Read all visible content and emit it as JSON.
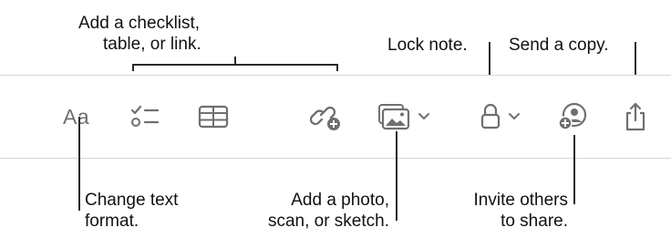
{
  "callouts": {
    "checklist_table_link": [
      "Add a checklist,",
      "table, or link."
    ],
    "lock_note": "Lock note.",
    "send_copy": "Send a copy.",
    "text_format": [
      "Change text",
      "format."
    ],
    "photo_scan_sketch": [
      "Add a photo,",
      "scan, or sketch."
    ],
    "invite_share": [
      "Invite others",
      "to share."
    ]
  },
  "toolbar": {
    "format_label": "Aa",
    "buttons": [
      {
        "name": "text-format",
        "icon": "text-format-icon"
      },
      {
        "name": "checklist",
        "icon": "checklist-icon"
      },
      {
        "name": "table",
        "icon": "table-icon"
      },
      {
        "name": "link",
        "icon": "link-icon"
      },
      {
        "name": "media",
        "icon": "photo-icon",
        "menu": "chevron-down-icon"
      },
      {
        "name": "lock",
        "icon": "lock-icon",
        "menu": "chevron-down-icon"
      },
      {
        "name": "collaborate",
        "icon": "add-person-icon"
      },
      {
        "name": "share",
        "icon": "share-icon"
      }
    ]
  },
  "colors": {
    "icon": "#6f6f6f",
    "callout_text": "#111111",
    "leader_line": "#2a2a2a",
    "divider": "#d7d7d7"
  }
}
